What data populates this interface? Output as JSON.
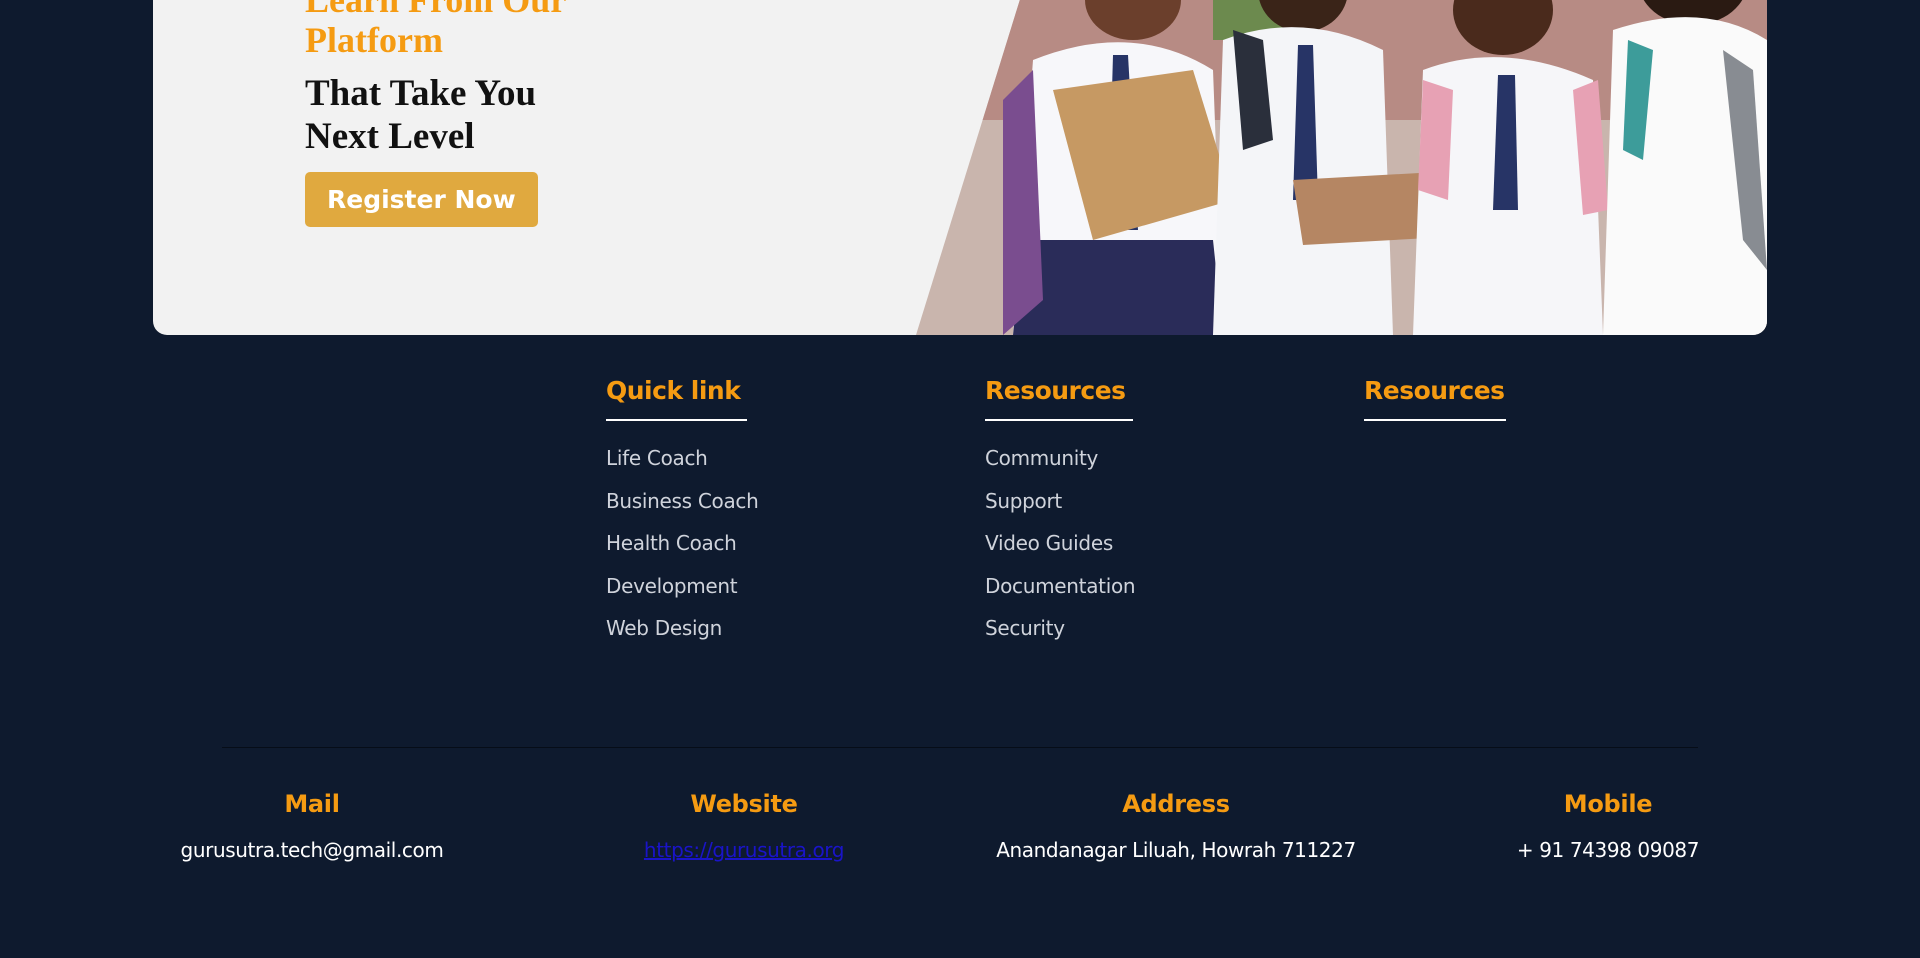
{
  "banner": {
    "headline_orange_1": "Learn From Our",
    "headline_orange_2": "Platform",
    "headline_black_1": "That Take You",
    "headline_black_2": "Next Level",
    "register_label": "Register Now"
  },
  "footer": {
    "columns": [
      {
        "title": "Quick link",
        "links": [
          "Life Coach",
          "Business Coach",
          "Health Coach",
          "Development",
          "Web Design"
        ]
      },
      {
        "title": "Resources",
        "links": [
          "Community",
          "Support",
          "Video Guides",
          "Documentation",
          "Security"
        ]
      },
      {
        "title": "Resources",
        "links": []
      }
    ],
    "contacts": [
      {
        "title": "Mail",
        "value": "gurusutra.tech@gmail.com"
      },
      {
        "title": "Website",
        "value": "https://gurusutra.org"
      },
      {
        "title": "Address",
        "value": "Anandanagar Liluah, Howrah 711227"
      },
      {
        "title": "Mobile",
        "value": "+ 91 74398 09087"
      }
    ]
  },
  "colors": {
    "background": "#0e1a2e",
    "accent": "#f59b12",
    "button": "#e0a93f",
    "link": "#1a14c9"
  }
}
